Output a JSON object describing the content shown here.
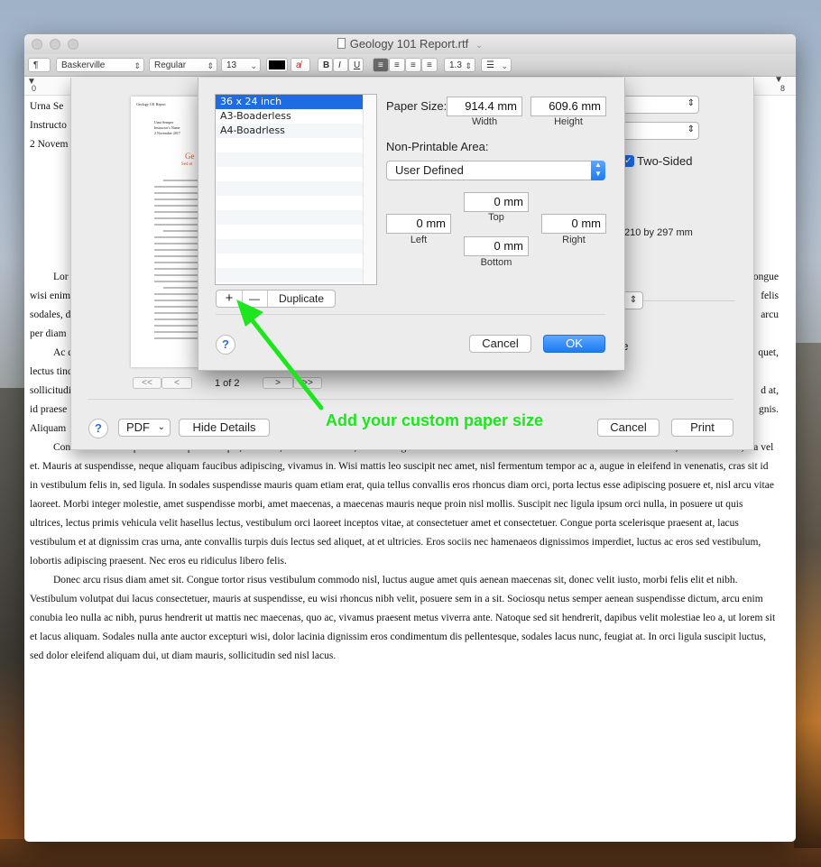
{
  "window": {
    "title": "Geology 101 Report.rtf",
    "title_chevron": "⌄"
  },
  "toolbar": {
    "paragraph_style": "¶",
    "font_family": "Baskerville",
    "font_style": "Regular",
    "font_size": "13",
    "bold": "B",
    "italic": "I",
    "underline": "U",
    "line_spacing": "1.3",
    "list_style": "☰"
  },
  "ruler": {
    "start": "0",
    "end": "8"
  },
  "document": {
    "header_lines": [
      "Urna Se",
      "Instructo",
      "2 Novem"
    ],
    "left_frag": [
      "Lor",
      "wisi enim",
      "sodales, d",
      "per diam",
      "Ac d",
      "lectus tinc",
      "sollicitudi",
      "id praese",
      "Aliquam"
    ],
    "right_frag": [
      "ongue",
      "felis",
      "arcu",
      "",
      "quet,",
      "",
      "d at,",
      "gnis.",
      ""
    ],
    "paragraph1": "Consectetuer arcu ipsum ornare pellentesque, vehicula, in vehicula diam, ornare magna erat felis wisi a risus. Justo fermentum id. Malesuada eleifend, tortor molestie, a a vel et. Mauris at suspendisse, neque aliquam faucibus adipiscing, vivamus in. Wisi mattis leo suscipit nec amet, nisl fermentum tempor ac a, augue in eleifend in venenatis, cras sit id in vestibulum felis in, sed ligula. In sodales suspendisse mauris quam etiam erat, quia tellus convallis eros rhoncus diam orci, porta lectus esse adipiscing posuere et, nisl arcu vitae laoreet. Morbi integer molestie, amet suspendisse morbi, amet maecenas, a maecenas mauris neque proin nisl mollis. Suscipit nec ligula ipsum orci nulla, in posuere ut quis ultrices, lectus primis vehicula velit hasellus lectus, vestibulum orci laoreet inceptos vitae, at consectetuer amet et consectetuer. Congue porta scelerisque praesent at, lacus vestibulum et at dignissim cras urna, ante convallis turpis duis lectus sed aliquet, at et ultricies. Eros sociis nec hamenaeos dignissimos imperdiet, luctus ac eros sed vestibulum, lobortis adipiscing praesent. Nec eros eu ridiculus libero felis.",
    "paragraph2": "Donec arcu risus diam amet sit. Congue tortor risus vestibulum commodo nisl, luctus augue amet quis aenean maecenas sit, donec velit iusto, morbi felis elit et nibh. Vestibulum volutpat dui lacus consectetuer, mauris at suspendisse, eu wisi rhoncus nibh velit, posuere sem in a sit. Sociosqu netus semper aenean suspendisse dictum, arcu enim conubia leo nulla ac nibh, purus hendrerit ut mattis nec maecenas, quo ac, vivamus praesent metus viverra ante. Natoque sed sit hendrerit, dapibus velit molestiae leo a, ut lorem sit et lacus aliquam. Sodales nulla ante auctor excepturi wisi, dolor lacinia dignissim eros condimentum dis pellentesque, sodales lacus nunc, feugiat at. In orci ligula suscipit luctus, sed dolor eleifend aliquam dui, ut diam mauris, sollicitudin sed nisl lacus."
  },
  "print_dialog": {
    "two_sided_label": "Two-Sided",
    "paper_dims": "210 by 297 mm",
    "partial_label": "ge",
    "page_indicator": "1 of 2",
    "nav_first": "<<",
    "nav_prev": "<",
    "nav_next": ">",
    "nav_last": ">>",
    "pdf_label": "PDF",
    "hide_details": "Hide Details",
    "cancel": "Cancel",
    "print": "Print",
    "help": "?",
    "preview": {
      "header": "Geology 101 Report",
      "name": "Urna Semper",
      "instructor": "Instructor's Name",
      "date": "2 November 2017",
      "title": "Ge",
      "subtitle": "Sed et"
    }
  },
  "custom_paper": {
    "sizes": [
      "36 x 24 inch",
      "A3-Boaderless",
      "A4-Boadrless"
    ],
    "add_symbol": "+",
    "remove_symbol": "—",
    "duplicate": "Duplicate",
    "paper_size_label": "Paper Size:",
    "width_value": "914.4 mm",
    "height_value": "609.6 mm",
    "width_label": "Width",
    "height_label": "Height",
    "non_printable_label": "Non-Printable Area:",
    "non_printable_value": "User Defined",
    "top_value": "0 mm",
    "left_value": "0 mm",
    "right_value": "0 mm",
    "bottom_value": "0 mm",
    "top_label": "Top",
    "left_label": "Left",
    "right_label": "Right",
    "bottom_label": "Bottom",
    "help": "?",
    "cancel": "Cancel",
    "ok": "OK"
  },
  "annotation": {
    "text": "Add your custom paper size",
    "color": "#1ee61e"
  },
  "colors": {
    "accent": "#1e6be4"
  }
}
